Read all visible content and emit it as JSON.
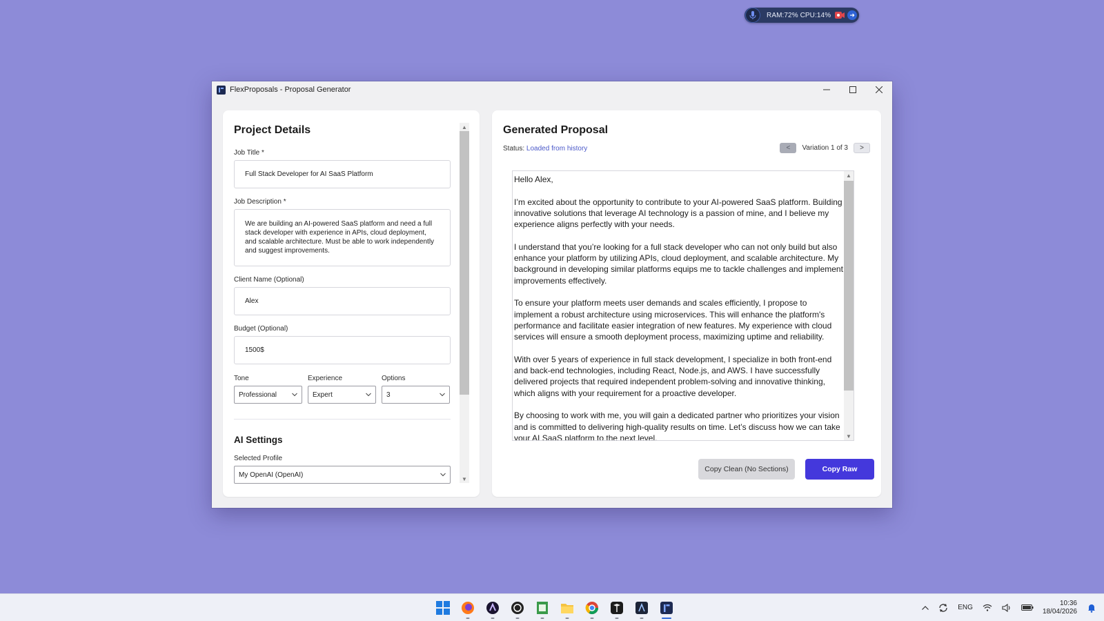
{
  "system_pill": {
    "stats": "RAM:72%  CPU:14%",
    "icons": [
      "microphone-icon",
      "record-icon",
      "arrow-right-icon"
    ]
  },
  "window": {
    "title": "FlexProposals - Proposal Generator",
    "controls": [
      "minimize",
      "maximize",
      "close"
    ]
  },
  "project_details": {
    "heading": "Project Details",
    "job_title_label": "Job Title *",
    "job_title_value": "Full Stack Developer for AI SaaS Platform",
    "job_description_label": "Job Description *",
    "job_description_value": "We are building an AI-powered SaaS platform and need a full stack developer with experience in APIs, cloud deployment, and scalable architecture. Must be able to work independently and suggest improvements.",
    "client_name_label": "Client Name (Optional)",
    "client_name_value": "Alex",
    "budget_label": "Budget (Optional)",
    "budget_value": "1500$",
    "tone_label": "Tone",
    "tone_value": "Professional",
    "experience_label": "Experience",
    "experience_value": "Expert",
    "options_label": "Options",
    "options_value": "3"
  },
  "ai_settings": {
    "heading": "AI Settings",
    "profile_label": "Selected Profile",
    "profile_value": "My OpenAI (OpenAI)"
  },
  "generated_proposal": {
    "heading": "Generated Proposal",
    "status_label": "Status:",
    "status_value": "Loaded from history",
    "prev_label": "<",
    "next_label": ">",
    "variation_label": "Variation 1 of 3",
    "paragraphs": [
      "Hello Alex,",
      "I’m excited about the opportunity to contribute to your AI-powered SaaS platform. Building innovative solutions that leverage AI technology is a passion of mine, and I believe my experience aligns perfectly with your needs.",
      "I understand that you’re looking for a full stack developer who can not only build but also enhance your platform by utilizing APIs, cloud deployment, and scalable architecture. My background in developing similar platforms equips me to tackle challenges and implement improvements effectively.",
      "To ensure your platform meets user demands and scales efficiently, I propose to implement a robust architecture using microservices. This will enhance the platform's performance and facilitate easier integration of new features. My experience with cloud services will ensure a smooth deployment process, maximizing uptime and reliability.",
      "With over 5 years of experience in full stack development, I specialize in both front-end and back-end technologies, including React, Node.js, and AWS. I have successfully delivered projects that required independent problem-solving and innovative thinking, which aligns with your requirement for a proactive developer.",
      "By choosing to work with me, you will gain a dedicated partner who prioritizes your vision and is committed to delivering high-quality results on time. Let’s discuss how we can take your AI SaaS platform to the next level."
    ],
    "copy_clean_label": "Copy Clean (No Sections)",
    "copy_raw_label": "Copy Raw"
  },
  "colors": {
    "desktop": "#8d8bd8",
    "accent": "#4438dc",
    "status_link": "#4b59c9"
  },
  "taskbar": {
    "apps": [
      "windows-start-icon",
      "firefox-icon",
      "app-purple-icon",
      "app-spiral-icon",
      "notepad-icon",
      "file-explorer-icon",
      "chrome-icon",
      "cube-app-icon",
      "a-app-icon",
      "flexproposals-icon"
    ],
    "language": "ENG",
    "time": "10:36",
    "date": "18/04/2026"
  }
}
